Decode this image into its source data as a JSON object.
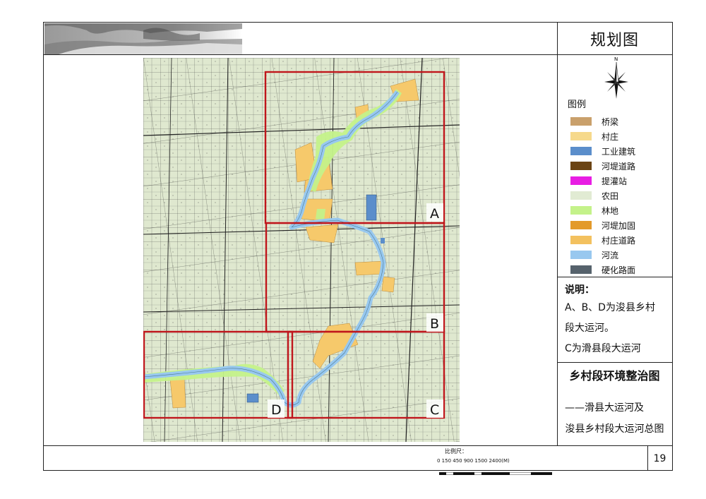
{
  "header": {
    "title": "规划图"
  },
  "legend": {
    "title": "图例",
    "items": [
      {
        "label": "桥梁",
        "color": "#c9a06b"
      },
      {
        "label": "村庄",
        "color": "#f6d98b"
      },
      {
        "label": "工业建筑",
        "color": "#5b8ecb"
      },
      {
        "label": "河堤道路",
        "color": "#6b4414"
      },
      {
        "label": "提灌站",
        "color": "#e81de3"
      },
      {
        "label": "农田",
        "color": "#e1ebd3"
      },
      {
        "label": "林地",
        "color": "#c4f28a"
      },
      {
        "label": "河堤加固",
        "color": "#e39a2a"
      },
      {
        "label": "村庄道路",
        "color": "#f3c15f"
      },
      {
        "label": "河流",
        "color": "#98c8ef"
      },
      {
        "label": "硬化路面",
        "color": "#56626c"
      }
    ]
  },
  "notes": {
    "title": "说明：",
    "lines": [
      "A、B、D为浚县乡村",
      "段大运河。",
      "C为滑县段大运河"
    ]
  },
  "drawing_title": {
    "main": "乡村段环境整治图",
    "sub1": "——滑县大运河及",
    "sub2": "浚县乡村段大运河总图"
  },
  "page_number": "19",
  "scale": {
    "label": "比例尺：",
    "ticks": "0 150 450    900       1500          2400(M)"
  },
  "compass_label": "N",
  "map": {
    "zones": [
      "A",
      "B",
      "C",
      "D"
    ],
    "colors": {
      "farmland": "#dfe8cf",
      "boundary": "#c0161c",
      "river": "#98c8ef",
      "forest": "#c4f28a",
      "village": "#f6c96b"
    }
  }
}
